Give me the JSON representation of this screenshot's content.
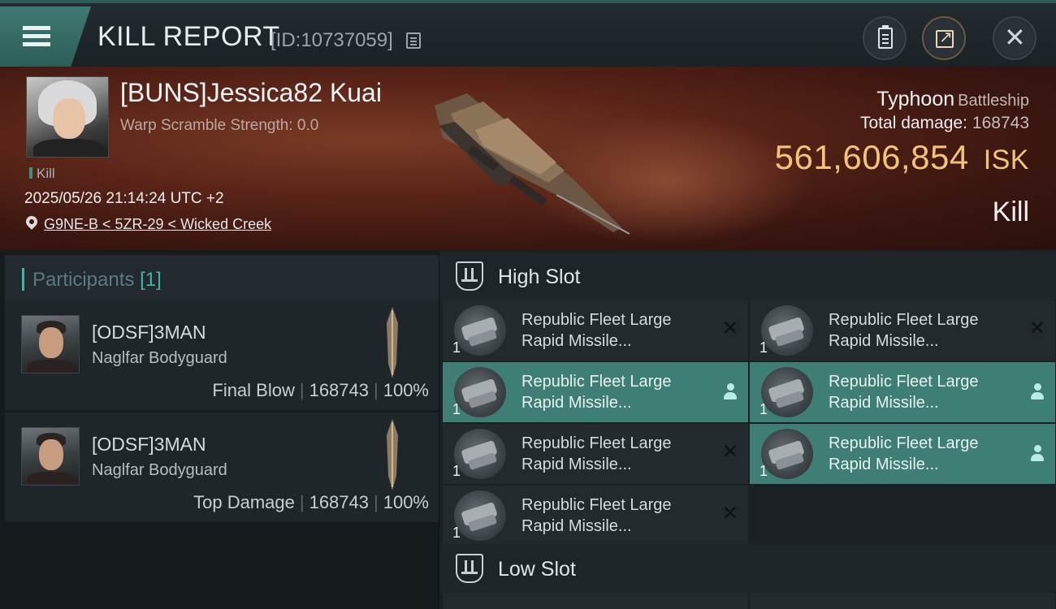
{
  "header": {
    "title": "KILL REPORT",
    "report_id": "[ID:10737059]",
    "icons": [
      "menu-icon",
      "copy-icon",
      "clipboard-icon",
      "share-icon",
      "close-icon"
    ]
  },
  "victim": {
    "name": "[BUNS]Jessica82 Kuai",
    "warp_scramble": "Warp Scramble Strength: 0.0",
    "tag": "Kill",
    "datetime": "2025/05/26 21:14:24 UTC +2",
    "location": "G9NE-B < 5ZR-29 < Wicked Creek",
    "ship": "Typhoon",
    "ship_class": "Battleship",
    "total_damage_label": "Total damage:",
    "total_damage": "168743",
    "isk_value": "561,606,854",
    "isk_unit": "ISK",
    "result": "Kill"
  },
  "participants": {
    "label": "Participants",
    "count": "[1]",
    "rows": [
      {
        "name": "[ODSF]3MAN",
        "ship": "Naglfar Bodyguard",
        "role": "Final Blow",
        "damage": "168743",
        "percent": "100%"
      },
      {
        "name": "[ODSF]3MAN",
        "ship": "Naglfar Bodyguard",
        "role": "Top Damage",
        "damage": "168743",
        "percent": "100%"
      }
    ]
  },
  "slots": {
    "high": {
      "title": "High Slot",
      "modules": [
        {
          "qty": "1",
          "line1": "Republic Fleet Large",
          "line2": "Rapid Missile...",
          "status": "destroyed"
        },
        {
          "qty": "1",
          "line1": "Republic Fleet Large",
          "line2": "Rapid Missile...",
          "status": "destroyed"
        },
        {
          "qty": "1",
          "line1": "Republic Fleet Large",
          "line2": "Rapid Missile...",
          "status": "dropped"
        },
        {
          "qty": "1",
          "line1": "Republic Fleet Large",
          "line2": "Rapid Missile...",
          "status": "dropped"
        },
        {
          "qty": "1",
          "line1": "Republic Fleet Large",
          "line2": "Rapid Missile...",
          "status": "destroyed"
        },
        {
          "qty": "1",
          "line1": "Republic Fleet Large",
          "line2": "Rapid Missile...",
          "status": "dropped"
        },
        {
          "qty": "1",
          "line1": "Republic Fleet Large",
          "line2": "Rapid Missile...",
          "status": "destroyed"
        }
      ]
    },
    "low": {
      "title": "Low Slot"
    }
  },
  "colors": {
    "accent": "#43b3a4",
    "highlight_row": "#3f7e74",
    "isk": "#f2c37a",
    "hero_bg": "#5a2518"
  }
}
